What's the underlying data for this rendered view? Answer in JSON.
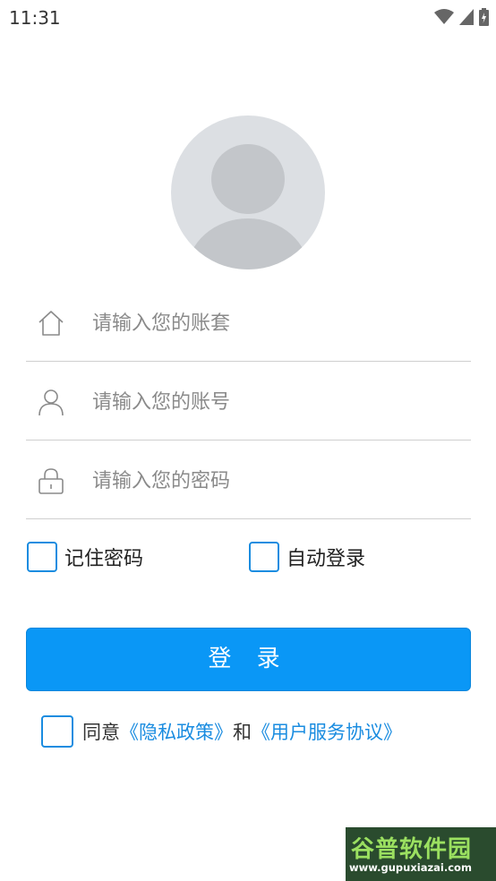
{
  "status_bar": {
    "time": "11:31"
  },
  "form": {
    "account_set_placeholder": "请输入您的账套",
    "username_placeholder": "请输入您的账号",
    "password_placeholder": "请输入您的密码"
  },
  "options": {
    "remember_password": "记住密码",
    "auto_login": "自动登录"
  },
  "login_button": "登 录",
  "agreement": {
    "prefix": "同意",
    "privacy_link": "《隐私政策》",
    "conjunction": "和",
    "user_agreement_link": "《用户服务协议》"
  },
  "watermark": {
    "title": "谷普软件园",
    "url": "www.gupuxiazai.com"
  },
  "colors": {
    "accent": "#0a97f6",
    "link": "#1a8ce0"
  }
}
